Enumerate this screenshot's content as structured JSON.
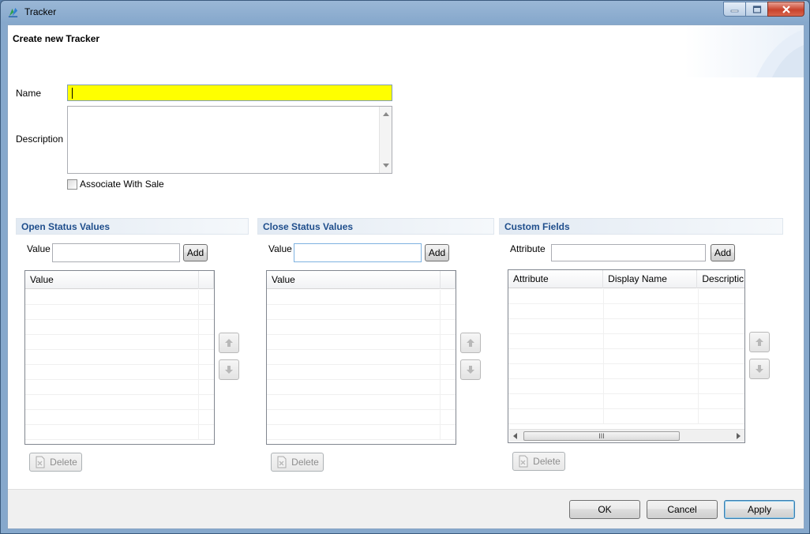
{
  "window": {
    "title": "Tracker",
    "icon": "tracker-app-icon",
    "controls": [
      "minimize-icon",
      "maximize-icon",
      "close-icon"
    ]
  },
  "dialog": {
    "title": "Create new Tracker"
  },
  "form": {
    "name_label": "Name",
    "name_value": "",
    "description_label": "Description",
    "description_value": "",
    "associate_label": "Associate With Sale",
    "associate_checked": false,
    "name_highlight_color": "#ffff00"
  },
  "open_status": {
    "heading": "Open Status Values",
    "value_label": "Value",
    "value_input": "",
    "add_label": "Add",
    "columns": [
      "Value",
      ""
    ],
    "rows": [],
    "delete_label": "Delete"
  },
  "close_status": {
    "heading": "Close Status Values",
    "value_label": "Value",
    "value_input": "",
    "add_label": "Add",
    "columns": [
      "Value",
      ""
    ],
    "rows": [],
    "delete_label": "Delete"
  },
  "custom_fields": {
    "heading": "Custom Fields",
    "attribute_label": "Attribute",
    "attribute_input": "",
    "add_label": "Add",
    "columns": [
      "Attribute",
      "Display Name",
      "Descriptic"
    ],
    "rows": [],
    "delete_label": "Delete",
    "scroll_grip": "III"
  },
  "footer": {
    "ok_label": "OK",
    "cancel_label": "Cancel",
    "apply_label": "Apply"
  },
  "colors": {
    "section_heading": "#1f4e8c",
    "default_button_border": "#3c7fb1"
  }
}
